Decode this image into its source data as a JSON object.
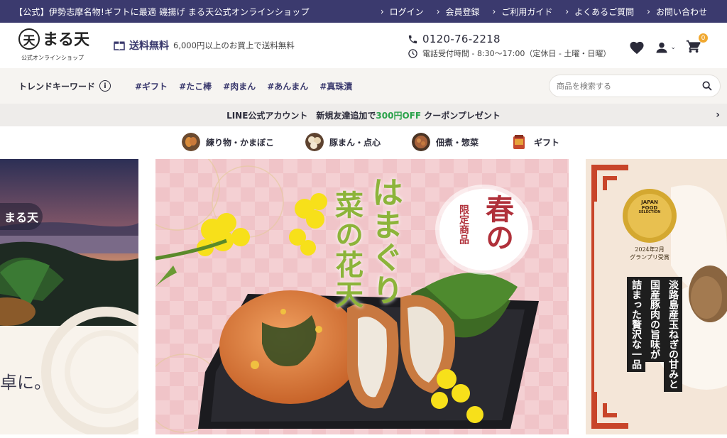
{
  "topbar": {
    "tagline": "【公式】伊勢志摩名物!ギフトに最適 磯揚げ まる天公式オンラインショップ",
    "nav": [
      "ログイン",
      "会員登録",
      "ご利用ガイド",
      "よくあるご質問",
      "お問い合わせ"
    ]
  },
  "header": {
    "logo_mark": "天",
    "logo_name": "まる天",
    "logo_sub": "公式オンラインショップ",
    "shipping_big": "送料無料",
    "shipping_small": "6,000円以上のお買上で送料無料",
    "phone": "0120-76-2218",
    "hours": "電話受付時間 - 8:30〜17:00（定休日 - 土曜・日曜）",
    "cart_count": "0"
  },
  "keywords": {
    "label": "トレンドキーワード",
    "items": [
      "#ギフト",
      "#たこ棒",
      "#肉まん",
      "#あんまん",
      "#真珠漬"
    ],
    "search_placeholder": "商品を検索する"
  },
  "line_banner": {
    "prefix": "LINE公式アカウント　新規友達追加で",
    "highlight": "300円OFF",
    "suffix": "クーポンプレゼント"
  },
  "categories": [
    "練り物・かまぼこ",
    "豚まん・点心",
    "佃煮・惣菜",
    "ギフト"
  ],
  "hero": {
    "left": {
      "logo_text": "まる天",
      "caption": "卓に。"
    },
    "center": {
      "title_line1": "はまぐり",
      "title_line2": "菜の花天",
      "badge_big": "春の",
      "badge_small": "限定商品"
    },
    "right": {
      "award_line1": "JAPAN",
      "award_line2": "FOOD",
      "award_line3": "SELECTION",
      "award_caption1": "2024年2月",
      "award_caption2": "グランプリ受賞",
      "col1": "淡路島産玉ねぎの甘みと",
      "col2": "国産豚肉の旨味が",
      "col3": "詰まった贅沢な一品"
    }
  },
  "colors": {
    "navy": "#3b3a6e",
    "accent_green": "#2aa24a",
    "cart_badge": "#f0a830",
    "title_green": "#8cb43a",
    "badge_red": "#b0303a"
  }
}
